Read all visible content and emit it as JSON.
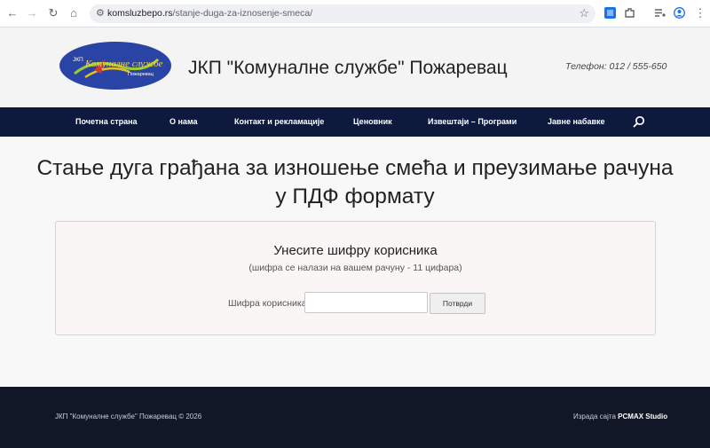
{
  "browser": {
    "url_domain": "komsluzbepo.rs",
    "url_path": "/stanje-duga-za-iznosenje-smeca/"
  },
  "header": {
    "logo_text": "Комуналне службе",
    "logo_prefix": "ЈКП",
    "logo_city": "Пожаревац",
    "title": "ЈКП \"Комуналне службе\" Пожаревац",
    "phone": "Телефон: 012 / 555-650"
  },
  "nav": {
    "items": [
      {
        "label": "Почетна страна"
      },
      {
        "label": "О нама"
      },
      {
        "label": "Контакт и рекламације"
      },
      {
        "label": "Ценовник"
      },
      {
        "label": "Извештаји – Програми"
      },
      {
        "label": "Јавне набавке"
      }
    ]
  },
  "main": {
    "heading_line1": "Стање дуга грађана за изношење смећа и преузимање рачуна",
    "heading_line2": "у ПДФ формату",
    "form": {
      "title": "Унесите шифру корисника",
      "hint": "(шифра се налази на вашем рачуну - 11 цифара)",
      "label": "Шифра корисника:",
      "value": "",
      "submit_label": "Потврди"
    }
  },
  "footer": {
    "copyright": "ЈКП \"Комуналне службе\" Пожаревац © 2026",
    "credits_prefix": "Израда сајта",
    "credits_studio": "PCMAX Studio"
  },
  "colors": {
    "nav_bg": "#0e1a3d",
    "footer_bg": "#111726",
    "logo_blue": "#2a44a6",
    "panel_bg": "#fbf6f6"
  }
}
